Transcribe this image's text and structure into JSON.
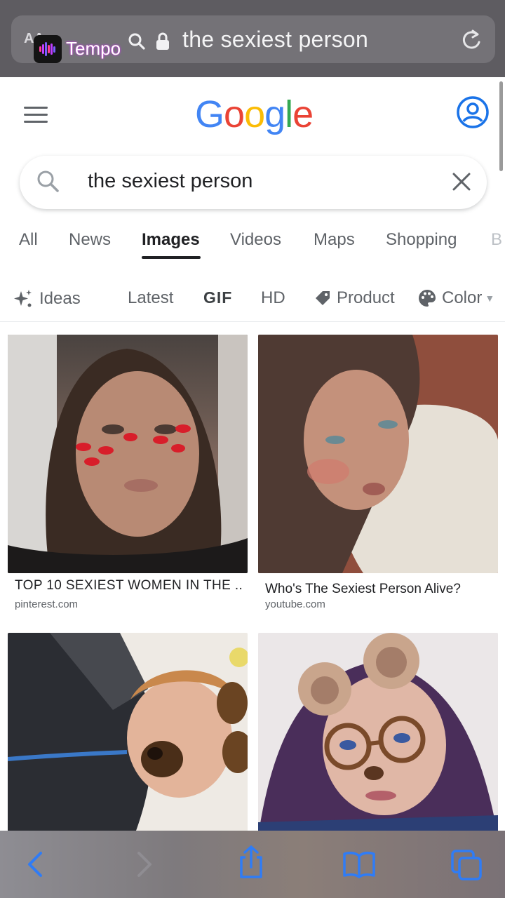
{
  "browser": {
    "aa_label": "AA",
    "overlay_app_label": "Tempo",
    "url_text": "the sexiest person"
  },
  "google": {
    "logo_letters": [
      "G",
      "o",
      "o",
      "g",
      "l",
      "e"
    ],
    "logo_colors": [
      "#4285f4",
      "#ea4335",
      "#fbbc05",
      "#4285f4",
      "#34a853",
      "#ea4335"
    ]
  },
  "search": {
    "query": "the sexiest person"
  },
  "tabs": [
    {
      "label": "All"
    },
    {
      "label": "News"
    },
    {
      "label": "Images",
      "active": true
    },
    {
      "label": "Videos"
    },
    {
      "label": "Maps"
    },
    {
      "label": "Shopping"
    },
    {
      "label": "B"
    }
  ],
  "chips": [
    {
      "label": "Ideas",
      "icon": "sparkle-icon"
    },
    {
      "label": "Latest"
    },
    {
      "label": "GIF"
    },
    {
      "label": "HD"
    },
    {
      "label": "Product",
      "icon": "tag-icon"
    },
    {
      "label": "Color",
      "icon": "palette-icon"
    }
  ],
  "results": [
    {
      "title": "TOP 10 SEXIEST WOMEN IN THE ..",
      "source": "pinterest.com"
    },
    {
      "title": "Who's The Sexiest Person Alive?",
      "source": "youtube.com"
    },
    {
      "title": "",
      "source": ""
    },
    {
      "title": "",
      "source": ""
    }
  ],
  "bottom_bar": {
    "buttons": [
      "back-icon",
      "forward-icon",
      "share-icon",
      "bookmarks-icon",
      "tabs-icon"
    ]
  },
  "colors": {
    "ios_blue": "#2f7cf6",
    "google_blue": "#1a73e8",
    "topbar": "#5e5c61"
  }
}
